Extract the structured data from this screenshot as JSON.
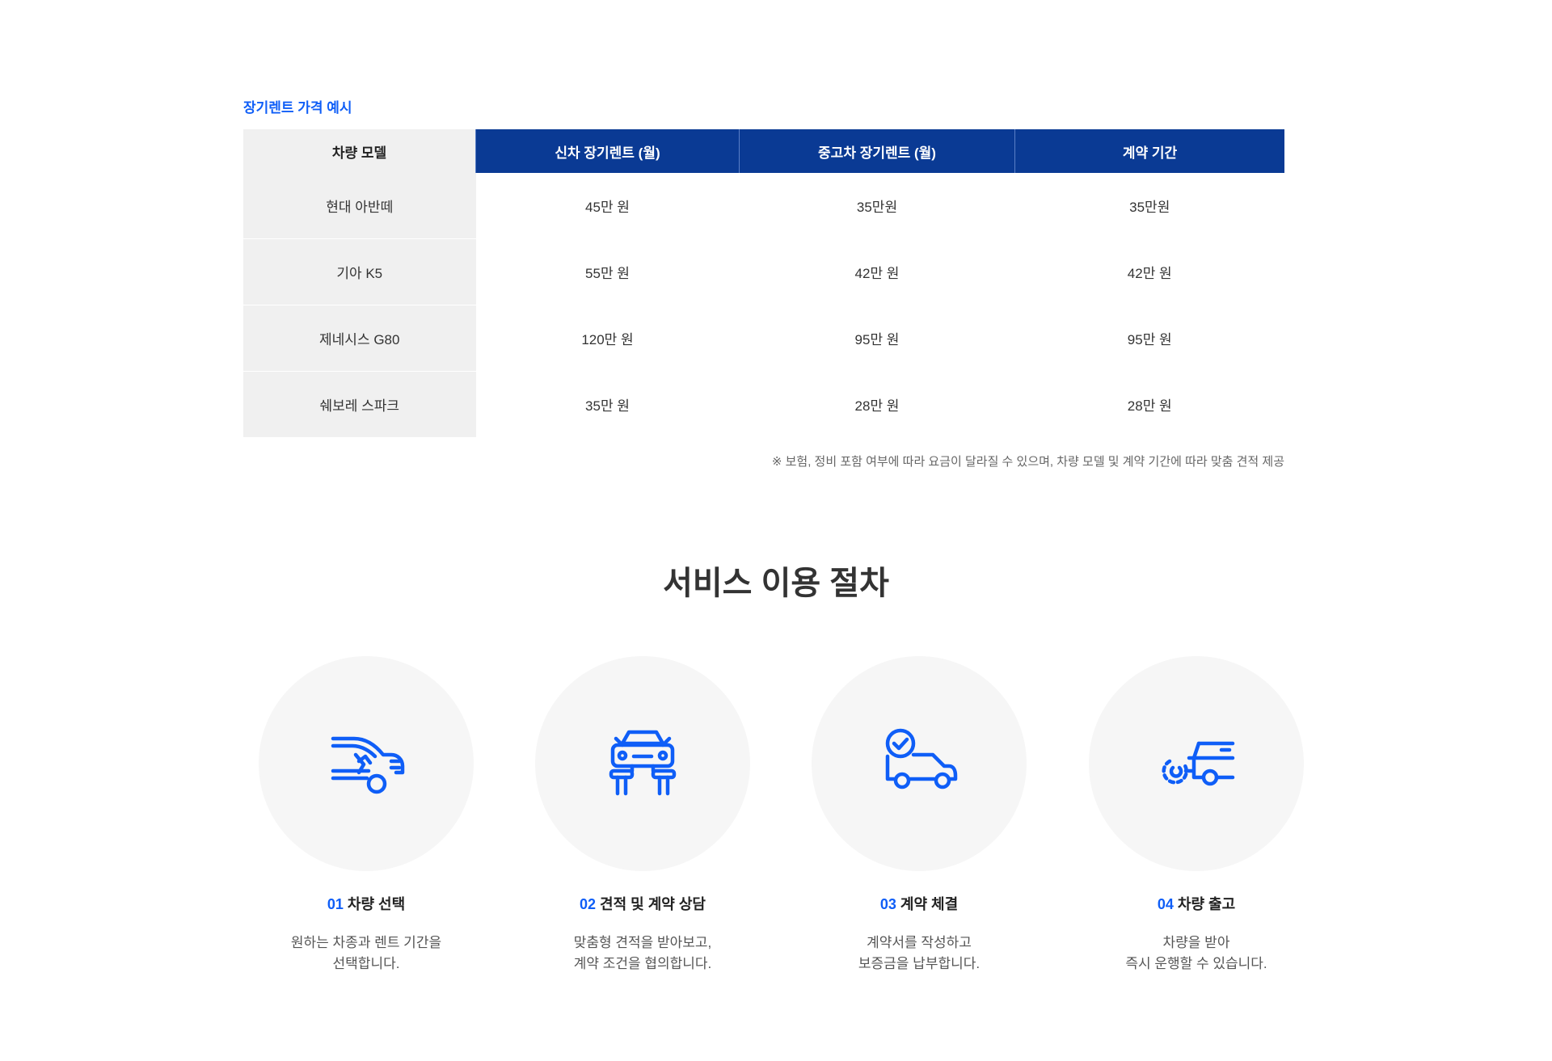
{
  "price_section": {
    "label": "장기렌트 가격 예시",
    "headers": [
      "차량 모델",
      "신차 장기렌트 (월)",
      "중고차 장기렌트 (월)",
      "계약 기간"
    ],
    "rows": [
      {
        "model": "현대 아반떼",
        "new": "45만 원",
        "used": "35만원",
        "term": "35만원"
      },
      {
        "model": "기아 K5",
        "new": "55만 원",
        "used": "42만 원",
        "term": "42만 원"
      },
      {
        "model": "제네시스 G80",
        "new": "120만 원",
        "used": "95만 원",
        "term": "95만 원"
      },
      {
        "model": "쉐보레 스파크",
        "new": "35만 원",
        "used": "28만 원",
        "term": "28만 원"
      }
    ],
    "note": "※ 보험, 정비 포함 여부에 따라 요금이 달라질 수 있으며, 차량 모델 및 계약 기간에 따라 맞춤 견적 제공"
  },
  "steps_section": {
    "title": "서비스 이용 절차",
    "steps": [
      {
        "num": "01",
        "title": "차량 선택",
        "desc": [
          "원하는 차종과 렌트 기간을",
          "선택합니다."
        ],
        "icon": "car-select-icon"
      },
      {
        "num": "02",
        "title": "견적 및 계약 상담",
        "desc": [
          "맞춤형 견적을 받아보고,",
          "계약 조건을 협의합니다."
        ],
        "icon": "car-lift-icon"
      },
      {
        "num": "03",
        "title": "계약 체결",
        "desc": [
          "계약서를 작성하고",
          "보증금을 납부합니다."
        ],
        "icon": "car-check-icon"
      },
      {
        "num": "04",
        "title": "차량 출고",
        "desc": [
          "차량을 받아",
          "즉시 운행할 수 있습니다."
        ],
        "icon": "car-delivery-icon"
      }
    ]
  },
  "colors": {
    "accent": "#0f5ef7",
    "header_blue": "#0a3a94",
    "cell_gray": "#f0f0f0",
    "circle_gray": "#f6f6f6"
  }
}
